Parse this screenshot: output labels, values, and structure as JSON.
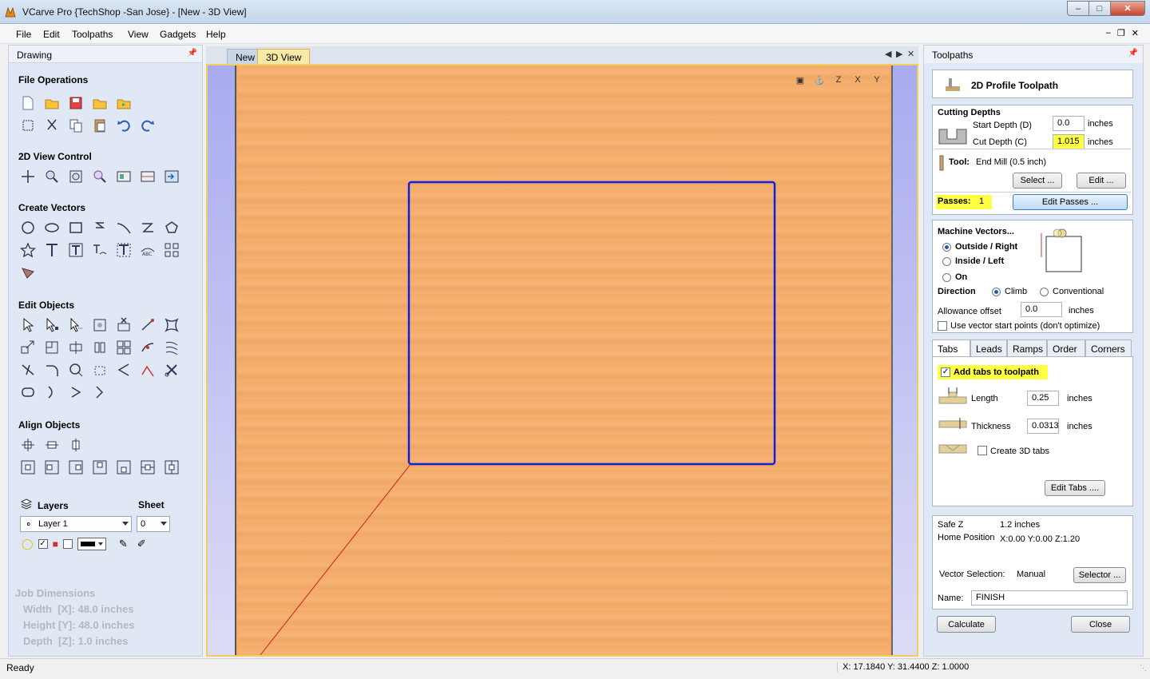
{
  "window": {
    "title": "VCarve Pro {TechShop -San Jose} - [New - 3D View]"
  },
  "menu": [
    "File",
    "Edit",
    "Toolpaths",
    "View",
    "Gadgets",
    "Help"
  ],
  "left_panel": {
    "title": "Drawing",
    "sections": {
      "file_ops": "File Operations",
      "view_control": "2D View Control",
      "create_vectors": "Create Vectors",
      "edit_objects": "Edit Objects",
      "align_objects": "Align Objects"
    },
    "layers_label": "Layers",
    "sheet_label": "Sheet",
    "layer_value": "Layer 1",
    "sheet_value": "0",
    "job_dimensions": {
      "title": "Job Dimensions",
      "width": "Width  [X]: 48.0 inches",
      "height": "Height [Y]: 48.0 inches",
      "depth": "Depth  [Z]: 1.0 inches"
    }
  },
  "view": {
    "tabs": [
      "New",
      "3D View"
    ],
    "active_tab": "3D View",
    "colors": {
      "wood": "#f4ab6a",
      "vector": "#1020e0",
      "line": "#c82020"
    }
  },
  "right_panel": {
    "title": "Toolpaths",
    "toolpath_name": "2D Profile Toolpath",
    "cutting_depths": "Cutting Depths",
    "start_depth_label": "Start Depth (D)",
    "start_depth": "0.0",
    "cut_depth_label": "Cut Depth (C)",
    "cut_depth": "1.015",
    "unit": "inches",
    "tool_label": "Tool:",
    "tool_value": "End Mill (0.5 inch)",
    "select_btn": "Select ...",
    "edit_btn": "Edit ...",
    "passes_label": "Passes:",
    "passes_value": "1",
    "edit_passes_btn": "Edit Passes ...",
    "machine_vectors": "Machine Vectors...",
    "outside": "Outside / Right",
    "inside": "Inside / Left",
    "on": "On",
    "direction": "Direction",
    "climb": "Climb",
    "conventional": "Conventional",
    "allowance_label": "Allowance offset",
    "allowance": "0.0",
    "use_vector_start": "Use vector start points (don't optimize)",
    "tabs": [
      "Tabs",
      "Leads",
      "Ramps",
      "Order",
      "Corners"
    ],
    "add_tabs": "Add tabs to toolpath",
    "length_label": "Length",
    "length": "0.25",
    "thickness_label": "Thickness",
    "thickness": "0.0313",
    "create_3d_tabs": "Create 3D tabs",
    "edit_tabs_btn": "Edit Tabs ....",
    "safe_z_label": "Safe Z",
    "safe_z": "1.2 inches",
    "home_label": "Home Position",
    "home": "X:0.00 Y:0.00 Z:1.20",
    "vector_selection_label": "Vector Selection:",
    "vector_selection": "Manual",
    "selector_btn": "Selector ...",
    "name_label": "Name:",
    "name_value": "FINISH",
    "calculate_btn": "Calculate",
    "close_btn": "Close"
  },
  "status": {
    "left": "Ready",
    "coords": "X: 17.1840 Y: 31.4400 Z:  1.0000"
  }
}
